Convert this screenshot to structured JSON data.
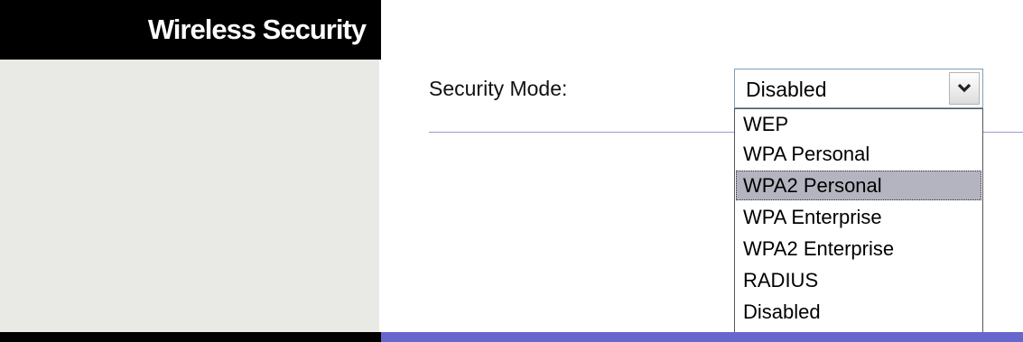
{
  "section": {
    "title": "Wireless Security"
  },
  "form": {
    "security_mode_label": "Security Mode:",
    "security_mode_value": "Disabled",
    "highlighted_option": "WPA2 Personal",
    "options": [
      "WEP",
      "WPA Personal",
      "WPA2 Personal",
      "WPA Enterprise",
      "WPA2 Enterprise",
      "RADIUS",
      "Disabled"
    ]
  },
  "icons": {
    "dropdown_arrow": "chevron-down-icon"
  },
  "colors": {
    "header_bg": "#000000",
    "sidebar_bg": "#e9e9e5",
    "separator": "#9a9ad8",
    "footer_accent": "#6666cc",
    "highlight": "#b4b4c0"
  }
}
